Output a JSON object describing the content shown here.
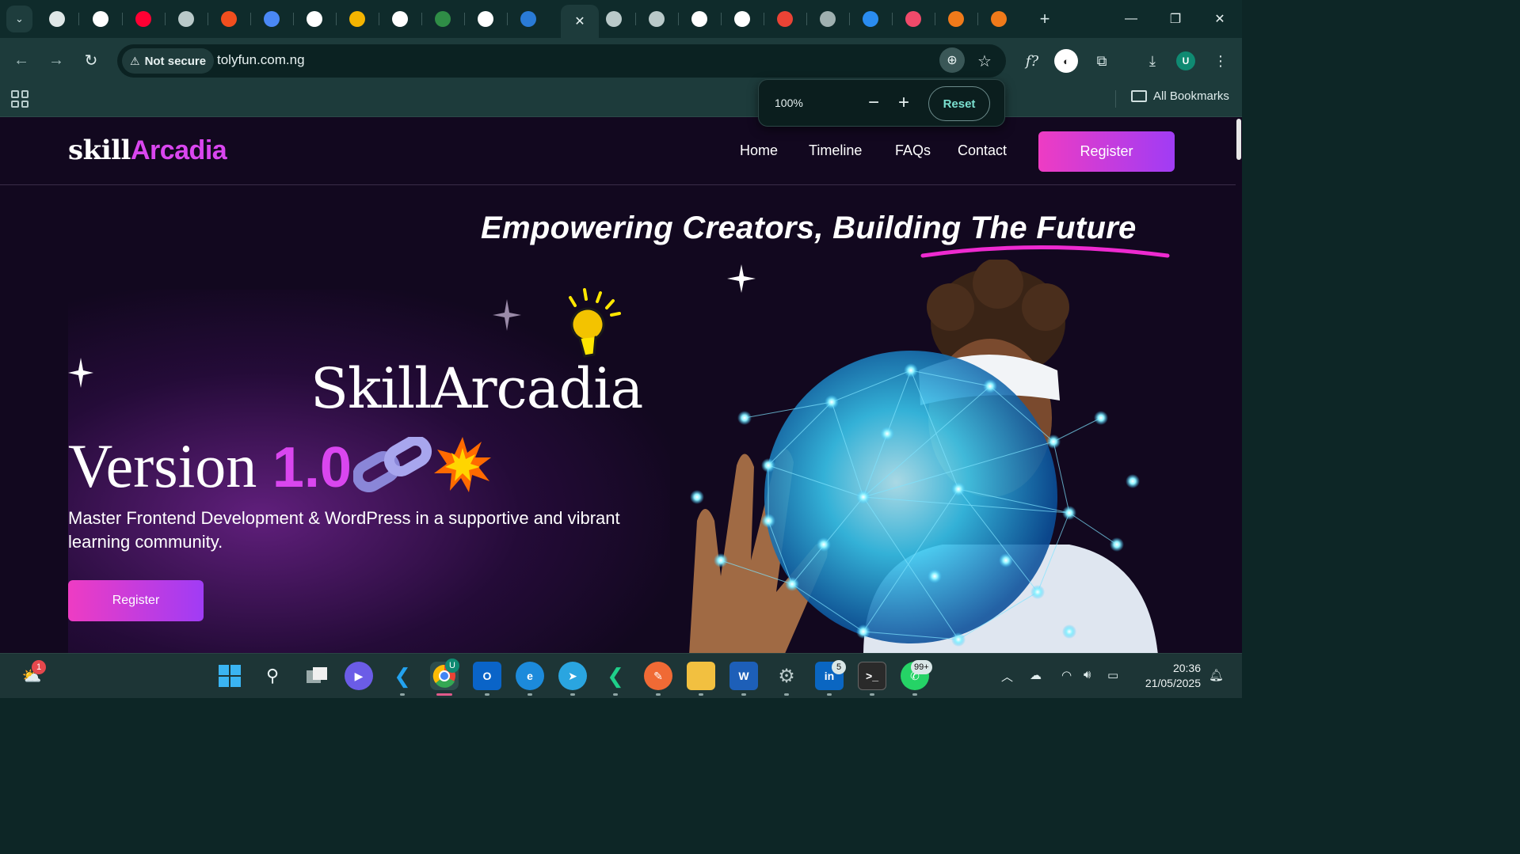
{
  "browser": {
    "security_label": "Not secure",
    "url": "tolyfun.com.ng",
    "zoom_level": "100%",
    "zoom_reset_label": "Reset",
    "all_bookmarks_label": "All Bookmarks",
    "profile_initial": "U",
    "tabs": [
      {
        "icon": "cube-icon",
        "color": "#dfe7e7"
      },
      {
        "icon": "github-icon",
        "color": "#ffffff"
      },
      {
        "icon": "youtube-icon",
        "color": "#ff0033"
      },
      {
        "icon": "globe-icon",
        "color": "#b9c9c9"
      },
      {
        "icon": "figma-icon",
        "color": "#f24e1e"
      },
      {
        "icon": "docs-icon",
        "color": "#4a88f5"
      },
      {
        "icon": "chatgpt-icon",
        "color": "#ffffff"
      },
      {
        "icon": "drive-icon",
        "color": "#f4b400"
      },
      {
        "icon": "slash-circle-icon",
        "color": "#ffffff"
      },
      {
        "icon": "gfg-icon",
        "color": "#2f8d46"
      },
      {
        "icon": "github-icon",
        "color": "#ffffff"
      },
      {
        "icon": "n-circle-icon",
        "color": "#2a7bd6"
      },
      {
        "icon": "globe-icon",
        "color": "#b9c9c9"
      },
      {
        "icon": "globe-icon",
        "color": "#b9c9c9"
      },
      {
        "icon": "chatgpt-icon",
        "color": "#ffffff"
      },
      {
        "icon": "github-icon",
        "color": "#ffffff"
      },
      {
        "icon": "gmail-icon",
        "color": "#ea4335"
      },
      {
        "icon": "ab-icon",
        "color": "#9fb0b0"
      },
      {
        "icon": "location-icon",
        "color": "#2a8cf0"
      },
      {
        "icon": "swirl-icon",
        "color": "#f04a6a"
      },
      {
        "icon": "cp-icon",
        "color": "#f07a1a"
      },
      {
        "icon": "cp-icon",
        "color": "#f07a1a"
      }
    ]
  },
  "site": {
    "logo_part1": "skill",
    "logo_part2": "Arcadia",
    "nav": [
      "Home",
      "Timeline",
      "FAQs",
      "Contact"
    ],
    "register_label": "Register",
    "tagline": "Empowering Creators, Building The Future",
    "hero_title": "SkillArcadia",
    "version_word": "Version",
    "version_number": "1.0",
    "hero_subtitle": "Master Frontend Development & WordPress in a supportive and vibrant learning community.",
    "hero_register_label": "Register",
    "colors": {
      "accent": "#d946ef",
      "gradient_start": "#ee3cc3",
      "gradient_end": "#a03cf5",
      "background": "#12081f"
    }
  },
  "taskbar": {
    "weather_badge": "1",
    "linkedin_badge": "5",
    "whatsapp_badge": "99+",
    "chrome_badge": "U",
    "time": "20:36",
    "date": "21/05/2025"
  }
}
